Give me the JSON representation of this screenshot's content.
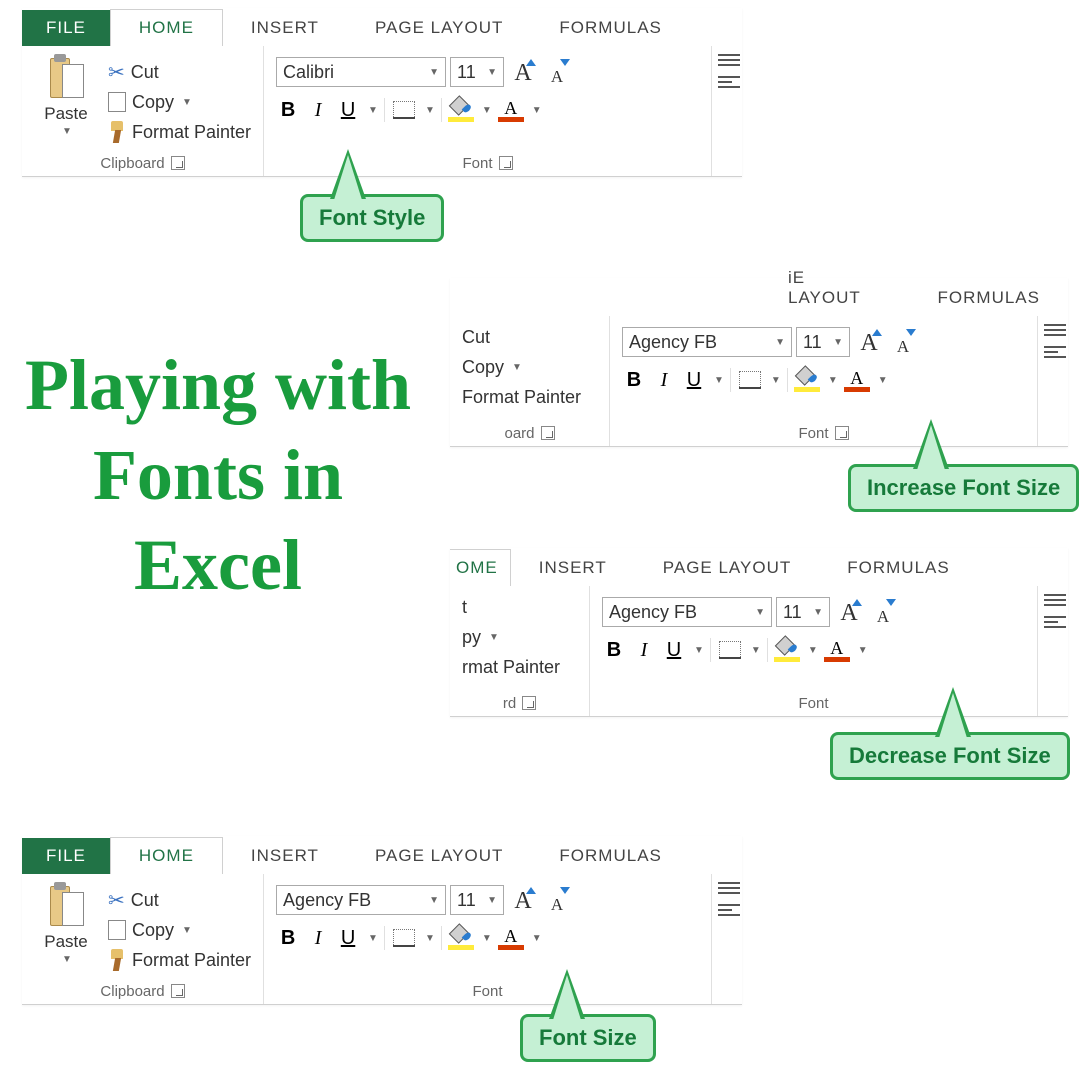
{
  "title": "Playing with Fonts in Excel",
  "tabs": {
    "file": "FILE",
    "home": "HOME",
    "insert": "INSERT",
    "page_layout": "PAGE LAYOUT",
    "formulas": "FORMULAS"
  },
  "clipboard": {
    "paste": "Paste",
    "cut": "Cut",
    "copy": "Copy",
    "format_painter": "Format Painter",
    "group_label": "Clipboard"
  },
  "font_group_label": "Font",
  "panel1": {
    "font_name": "Calibri",
    "font_size": "11",
    "callout": "Font Style"
  },
  "panel2": {
    "tabs_visible": {
      "l": "iE LAYOUT",
      "r": "FORMULAS"
    },
    "clip_partial": {
      "cut": "Cut",
      "copy": "Copy",
      "fp": "Format Painter",
      "grp": "oard"
    },
    "font_name": "Agency FB",
    "font_size": "11",
    "callout": "Increase Font Size"
  },
  "panel3": {
    "tabs_visible": {
      "h": "OME",
      "i": "INSERT",
      "pl": "PAGE LAYOUT",
      "f": "FORMULAS"
    },
    "clip_partial": {
      "cut": "t",
      "copy": "py",
      "fp": "rmat Painter",
      "grp": "rd"
    },
    "font_name": "Agency FB",
    "font_size": "11",
    "callout": "Decrease Font Size"
  },
  "panel4": {
    "font_name": "Agency FB",
    "font_size": "11",
    "callout": "Font Size"
  },
  "buttons": {
    "B": "B",
    "I": "I",
    "U": "U",
    "A": "A"
  },
  "partial_font_label": "Font"
}
